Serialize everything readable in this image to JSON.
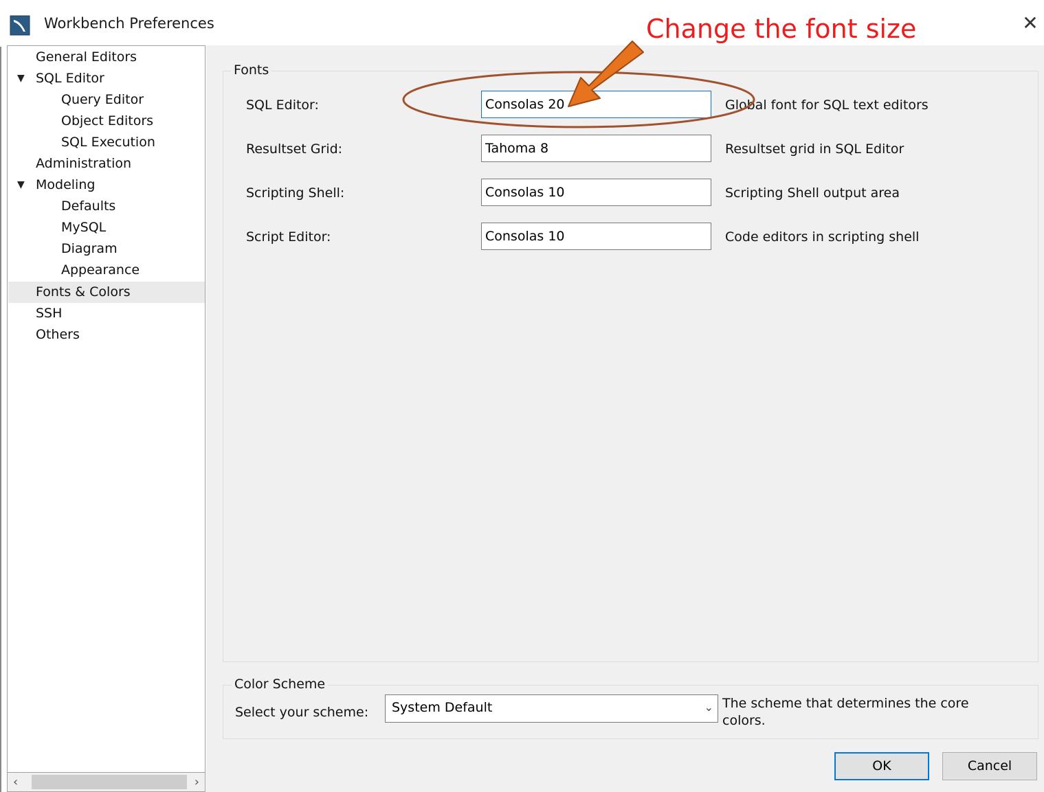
{
  "window": {
    "title": "Workbench Preferences",
    "close_glyph": "✕"
  },
  "annotation": {
    "text": "Change the font size",
    "color": "#ee1c1c",
    "arrow_color": "#e8731f",
    "ellipse_color": "#a0522d"
  },
  "sidebar": {
    "items": [
      {
        "label": "General Editors"
      },
      {
        "label": "SQL Editor",
        "expander": "▼"
      },
      {
        "label": "Query Editor"
      },
      {
        "label": "Object Editors"
      },
      {
        "label": "SQL Execution"
      },
      {
        "label": "Administration"
      },
      {
        "label": "Modeling",
        "expander": "▼"
      },
      {
        "label": "Defaults"
      },
      {
        "label": "MySQL"
      },
      {
        "label": "Diagram"
      },
      {
        "label": "Appearance"
      },
      {
        "label": "Fonts & Colors",
        "selected": true
      },
      {
        "label": "SSH"
      },
      {
        "label": "Others"
      }
    ],
    "scroll_left": "‹",
    "scroll_right": "›"
  },
  "fonts": {
    "group_title": "Fonts",
    "rows": [
      {
        "label": "SQL Editor:",
        "value": "Consolas 20",
        "description": "Global font for SQL text editors"
      },
      {
        "label": "Resultset Grid:",
        "value": "Tahoma 8",
        "description": "Resultset grid in SQL Editor"
      },
      {
        "label": "Scripting Shell:",
        "value": "Consolas 10",
        "description": "Scripting Shell output area"
      },
      {
        "label": "Script Editor:",
        "value": "Consolas 10",
        "description": "Code editors in scripting shell"
      }
    ]
  },
  "color_scheme": {
    "group_title": "Color Scheme",
    "label": "Select your scheme:",
    "selected": "System Default",
    "description_line1": "The scheme that determines the core",
    "description_line2": "colors."
  },
  "buttons": {
    "ok": "OK",
    "cancel": "Cancel"
  },
  "icons": {
    "app": "mysql-workbench-icon",
    "close": "close-icon",
    "chevron": "chevron-down-icon"
  }
}
